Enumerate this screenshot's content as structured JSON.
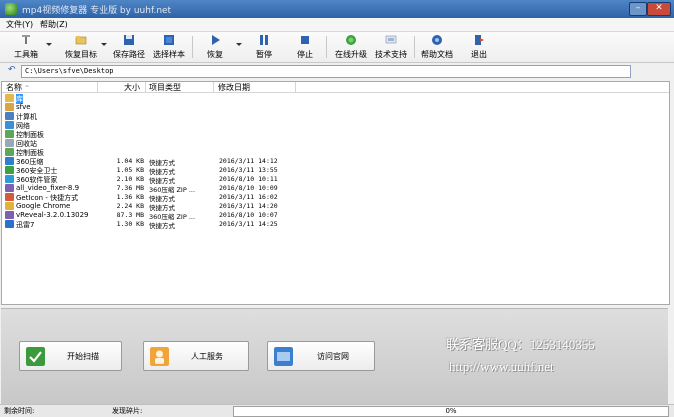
{
  "titlebar": {
    "title": "mp4视频修复器 专业版 by uuhf.net"
  },
  "menu": {
    "file": "文件(Y)",
    "help": "帮助(Z)"
  },
  "toolbar": {
    "toolbox": "工具箱",
    "restore_target": "恢复目标",
    "save_path": "保存路径",
    "select_sample": "选择样本",
    "recover": "恢复",
    "pause": "暂停",
    "stop": "停止",
    "online_upgrade": "在线升级",
    "tech_support": "技术支持",
    "help_doc": "帮助文档",
    "exit": "退出"
  },
  "address": {
    "path": "C:\\Users\\sfve\\Desktop"
  },
  "columns": {
    "name": "名称",
    "size": "大小",
    "type": "项目类型",
    "date": "修改日期"
  },
  "files": [
    {
      "name": "库",
      "size": "",
      "type": "",
      "date": "",
      "icon": "#e6b84a"
    },
    {
      "name": "sfve",
      "size": "",
      "type": "",
      "date": "",
      "icon": "#d9a441"
    },
    {
      "name": "计算机",
      "size": "",
      "type": "",
      "date": "",
      "icon": "#4a7fc1"
    },
    {
      "name": "网络",
      "size": "",
      "type": "",
      "date": "",
      "icon": "#3b8fd6"
    },
    {
      "name": "控制面板",
      "size": "",
      "type": "",
      "date": "",
      "icon": "#5fa55a"
    },
    {
      "name": "回收站",
      "size": "",
      "type": "",
      "date": "",
      "icon": "#9aa8b5"
    },
    {
      "name": "控制面板",
      "size": "",
      "type": "",
      "date": "",
      "icon": "#5fa55a"
    },
    {
      "name": "360压缩",
      "size": "1.04 KB",
      "type": "快捷方式",
      "date": "2016/3/11 14:12",
      "icon": "#2f7fd1"
    },
    {
      "name": "360安全卫士",
      "size": "1.05 KB",
      "type": "快捷方式",
      "date": "2016/3/11 13:55",
      "icon": "#3aa244"
    },
    {
      "name": "360软件管家",
      "size": "2.10 KB",
      "type": "快捷方式",
      "date": "2016/8/10 10:11",
      "icon": "#2e9ad8"
    },
    {
      "name": "all_video_fixer-8.9",
      "size": "7.36 MB",
      "type": "360压缩 ZIP ...",
      "date": "2016/8/10 10:09",
      "icon": "#7e5fb0"
    },
    {
      "name": "GetIcon - 快捷方式",
      "size": "1.36 KB",
      "type": "快捷方式",
      "date": "2016/3/11 16:02",
      "icon": "#d45a3c"
    },
    {
      "name": "Google Chrome",
      "size": "2.24 KB",
      "type": "快捷方式",
      "date": "2016/3/11 14:20",
      "icon": "#e0b43a"
    },
    {
      "name": "vReveal-3.2.0.13029",
      "size": "87.3 MB",
      "type": "360压缩 ZIP ...",
      "date": "2016/8/10 10:07",
      "icon": "#7e5fb0"
    },
    {
      "name": "迅雷7",
      "size": "1.30 KB",
      "type": "快捷方式",
      "date": "2016/3/11 14:25",
      "icon": "#2b6fcf"
    }
  ],
  "actions": {
    "start_scan": "开始扫描",
    "manual_service": "人工服务",
    "visit_site": "访问官网"
  },
  "contact": {
    "qq": "联系客服QQ：1253140355",
    "url": "http://www.uuhf.net"
  },
  "status": {
    "time_label": "剩余时间:",
    "fragments_label": "发现碎片:",
    "progress": 0,
    "progress_text": "0%"
  },
  "colors": {
    "titlebar": "#3a6fb5",
    "selection": "#3399ff",
    "progress_fill": "#3c9f3c"
  }
}
